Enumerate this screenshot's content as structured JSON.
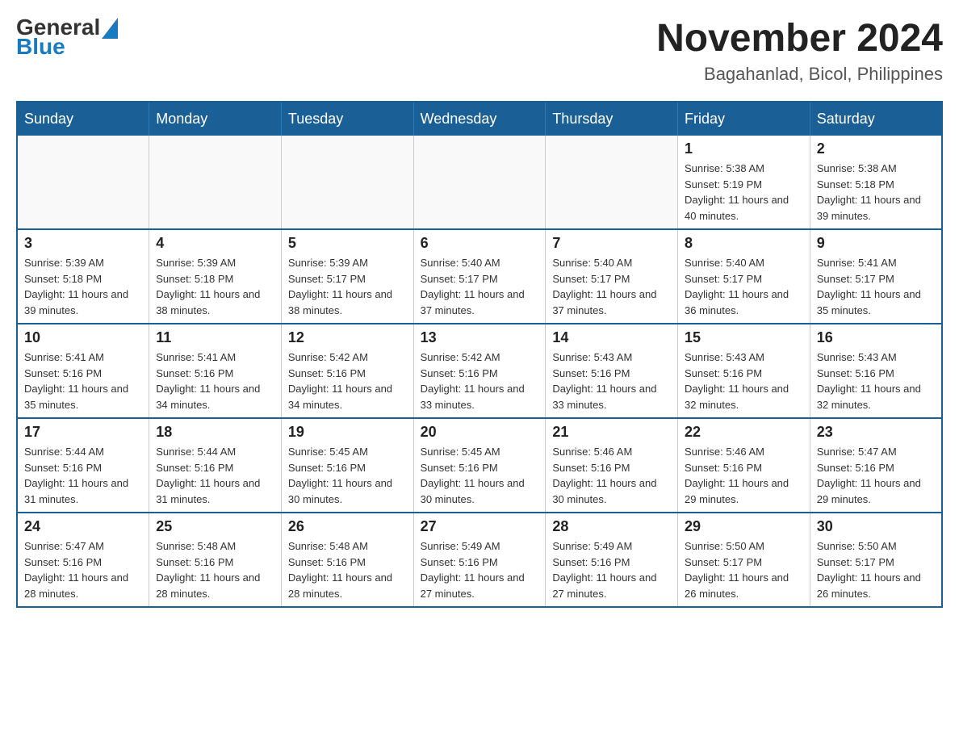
{
  "header": {
    "logo_general": "General",
    "logo_blue": "Blue",
    "month_title": "November 2024",
    "location": "Bagahanlad, Bicol, Philippines"
  },
  "weekdays": [
    "Sunday",
    "Monday",
    "Tuesday",
    "Wednesday",
    "Thursday",
    "Friday",
    "Saturday"
  ],
  "weeks": [
    [
      {
        "day": "",
        "info": ""
      },
      {
        "day": "",
        "info": ""
      },
      {
        "day": "",
        "info": ""
      },
      {
        "day": "",
        "info": ""
      },
      {
        "day": "",
        "info": ""
      },
      {
        "day": "1",
        "info": "Sunrise: 5:38 AM\nSunset: 5:19 PM\nDaylight: 11 hours and 40 minutes."
      },
      {
        "day": "2",
        "info": "Sunrise: 5:38 AM\nSunset: 5:18 PM\nDaylight: 11 hours and 39 minutes."
      }
    ],
    [
      {
        "day": "3",
        "info": "Sunrise: 5:39 AM\nSunset: 5:18 PM\nDaylight: 11 hours and 39 minutes."
      },
      {
        "day": "4",
        "info": "Sunrise: 5:39 AM\nSunset: 5:18 PM\nDaylight: 11 hours and 38 minutes."
      },
      {
        "day": "5",
        "info": "Sunrise: 5:39 AM\nSunset: 5:17 PM\nDaylight: 11 hours and 38 minutes."
      },
      {
        "day": "6",
        "info": "Sunrise: 5:40 AM\nSunset: 5:17 PM\nDaylight: 11 hours and 37 minutes."
      },
      {
        "day": "7",
        "info": "Sunrise: 5:40 AM\nSunset: 5:17 PM\nDaylight: 11 hours and 37 minutes."
      },
      {
        "day": "8",
        "info": "Sunrise: 5:40 AM\nSunset: 5:17 PM\nDaylight: 11 hours and 36 minutes."
      },
      {
        "day": "9",
        "info": "Sunrise: 5:41 AM\nSunset: 5:17 PM\nDaylight: 11 hours and 35 minutes."
      }
    ],
    [
      {
        "day": "10",
        "info": "Sunrise: 5:41 AM\nSunset: 5:16 PM\nDaylight: 11 hours and 35 minutes."
      },
      {
        "day": "11",
        "info": "Sunrise: 5:41 AM\nSunset: 5:16 PM\nDaylight: 11 hours and 34 minutes."
      },
      {
        "day": "12",
        "info": "Sunrise: 5:42 AM\nSunset: 5:16 PM\nDaylight: 11 hours and 34 minutes."
      },
      {
        "day": "13",
        "info": "Sunrise: 5:42 AM\nSunset: 5:16 PM\nDaylight: 11 hours and 33 minutes."
      },
      {
        "day": "14",
        "info": "Sunrise: 5:43 AM\nSunset: 5:16 PM\nDaylight: 11 hours and 33 minutes."
      },
      {
        "day": "15",
        "info": "Sunrise: 5:43 AM\nSunset: 5:16 PM\nDaylight: 11 hours and 32 minutes."
      },
      {
        "day": "16",
        "info": "Sunrise: 5:43 AM\nSunset: 5:16 PM\nDaylight: 11 hours and 32 minutes."
      }
    ],
    [
      {
        "day": "17",
        "info": "Sunrise: 5:44 AM\nSunset: 5:16 PM\nDaylight: 11 hours and 31 minutes."
      },
      {
        "day": "18",
        "info": "Sunrise: 5:44 AM\nSunset: 5:16 PM\nDaylight: 11 hours and 31 minutes."
      },
      {
        "day": "19",
        "info": "Sunrise: 5:45 AM\nSunset: 5:16 PM\nDaylight: 11 hours and 30 minutes."
      },
      {
        "day": "20",
        "info": "Sunrise: 5:45 AM\nSunset: 5:16 PM\nDaylight: 11 hours and 30 minutes."
      },
      {
        "day": "21",
        "info": "Sunrise: 5:46 AM\nSunset: 5:16 PM\nDaylight: 11 hours and 30 minutes."
      },
      {
        "day": "22",
        "info": "Sunrise: 5:46 AM\nSunset: 5:16 PM\nDaylight: 11 hours and 29 minutes."
      },
      {
        "day": "23",
        "info": "Sunrise: 5:47 AM\nSunset: 5:16 PM\nDaylight: 11 hours and 29 minutes."
      }
    ],
    [
      {
        "day": "24",
        "info": "Sunrise: 5:47 AM\nSunset: 5:16 PM\nDaylight: 11 hours and 28 minutes."
      },
      {
        "day": "25",
        "info": "Sunrise: 5:48 AM\nSunset: 5:16 PM\nDaylight: 11 hours and 28 minutes."
      },
      {
        "day": "26",
        "info": "Sunrise: 5:48 AM\nSunset: 5:16 PM\nDaylight: 11 hours and 28 minutes."
      },
      {
        "day": "27",
        "info": "Sunrise: 5:49 AM\nSunset: 5:16 PM\nDaylight: 11 hours and 27 minutes."
      },
      {
        "day": "28",
        "info": "Sunrise: 5:49 AM\nSunset: 5:16 PM\nDaylight: 11 hours and 27 minutes."
      },
      {
        "day": "29",
        "info": "Sunrise: 5:50 AM\nSunset: 5:17 PM\nDaylight: 11 hours and 26 minutes."
      },
      {
        "day": "30",
        "info": "Sunrise: 5:50 AM\nSunset: 5:17 PM\nDaylight: 11 hours and 26 minutes."
      }
    ]
  ]
}
